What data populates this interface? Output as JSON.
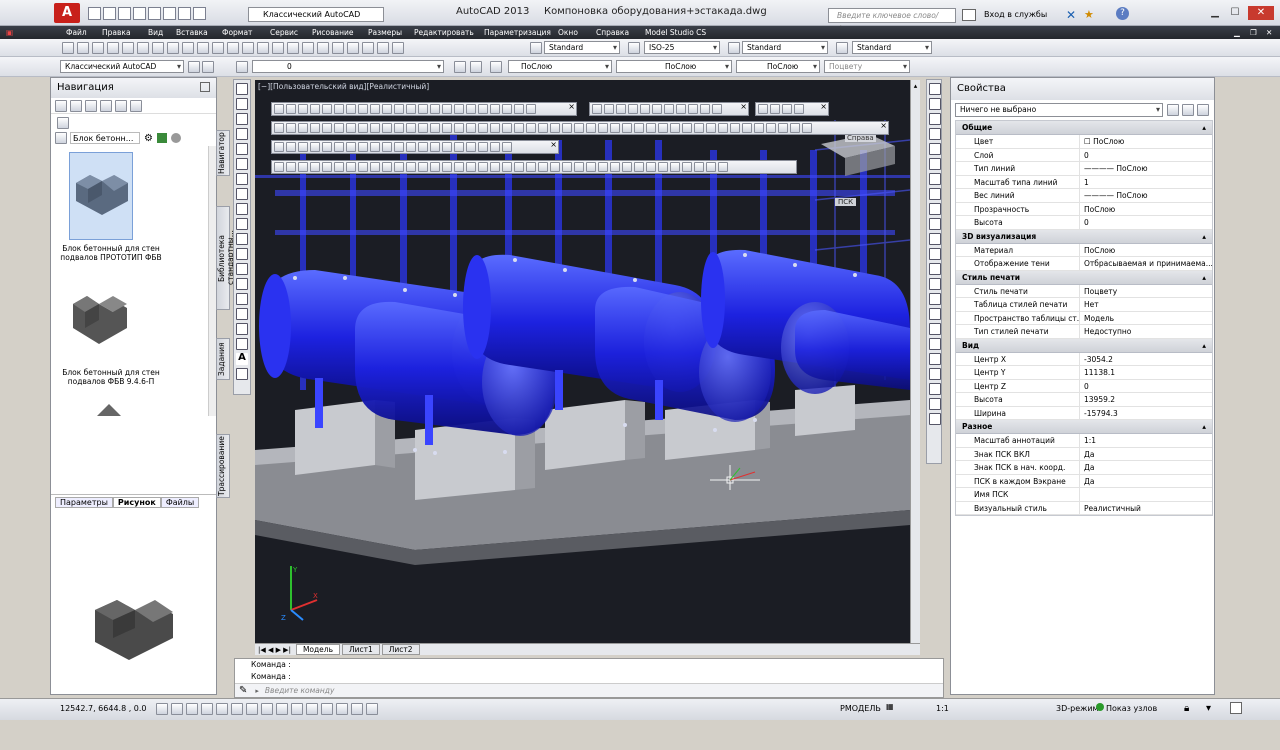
{
  "title_bar": {
    "app_logo": "A",
    "workspace": "Классический AutoCAD",
    "app_name": "AutoCAD 2013",
    "document": "Компоновка оборудования+эстакада.dwg",
    "search_placeholder": "Введите ключевое слово/фразу",
    "login": "Вход в службы"
  },
  "menu": [
    "Файл",
    "Правка",
    "Вид",
    "Вставка",
    "Формат",
    "Сервис",
    "Рисование",
    "Размеры",
    "Редактировать",
    "Параметризация",
    "Окно",
    "Справка",
    "Model Studio CS"
  ],
  "toolbar2": {
    "text_style": "Standard",
    "dim_style": "ISO-25",
    "table_style": "Standard",
    "mleader_style": "Standard"
  },
  "toolbar3": {
    "workspace": "Классический AutoCAD",
    "layer": "0",
    "color": "ПоСлою",
    "linetype": "ПоСлою",
    "lineweight": "ПоСлою",
    "plotstyle": "Поцвету"
  },
  "nav_panel": {
    "title": "Навигация",
    "block_name": "Блок бетонн...",
    "items": [
      {
        "label": "Блок бетонный для стен подвалов ПРОТОТИП ФБВ"
      },
      {
        "label": "Блок бетонный для стен подвалов ФБВ 9.4.6-П"
      }
    ],
    "tabs": [
      "Параметры",
      "Рисунок",
      "Файлы"
    ],
    "side_tabs": [
      "Навигатор",
      "Библиотека стандартны...",
      "Задания",
      "Трассирование"
    ]
  },
  "viewport": {
    "label": "[−][Пользовательский вид][Реалистичный]",
    "wcs_label": "ПСК",
    "cube_label": "Справа"
  },
  "layout_tabs": [
    "Модель",
    "Лист1",
    "Лист2"
  ],
  "command": {
    "line1": "Команда :",
    "line2": "Команда :",
    "placeholder": "Введите команду"
  },
  "status_bar": {
    "coords": "12542.7, 6644.8 , 0.0",
    "model": "РМОДЕЛЬ",
    "scale": "1:1",
    "mode3d": "3D-режим",
    "show_nodes": "Показ узлов"
  },
  "properties": {
    "title": "Свойства",
    "selection": "Ничего не выбрано",
    "groups": [
      {
        "name": "Общие",
        "rows": [
          [
            "Цвет",
            "☐ ПоСлою"
          ],
          [
            "Слой",
            "0"
          ],
          [
            "Тип линий",
            "———— ПоСлою"
          ],
          [
            "Масштаб типа линий",
            "1"
          ],
          [
            "Вес линий",
            "———— ПоСлою"
          ],
          [
            "Прозрачность",
            "ПоСлою"
          ],
          [
            "Высота",
            "0"
          ]
        ]
      },
      {
        "name": "3D визуализация",
        "rows": [
          [
            "Материал",
            "ПоСлою"
          ],
          [
            "Отображение тени",
            "Отбрасываемая и принимаема..."
          ]
        ]
      },
      {
        "name": "Стиль печати",
        "rows": [
          [
            "Стиль печати",
            "Поцвету"
          ],
          [
            "Таблица стилей печати",
            "Нет"
          ],
          [
            "Пространство таблицы ст...",
            "Модель"
          ],
          [
            "Тип стилей печати",
            "Недоступно"
          ]
        ]
      },
      {
        "name": "Вид",
        "rows": [
          [
            "Центр X",
            "-3054.2"
          ],
          [
            "Центр Y",
            "11138.1"
          ],
          [
            "Центр Z",
            "0"
          ],
          [
            "Высота",
            "13959.2"
          ],
          [
            "Ширина",
            "-15794.3"
          ]
        ]
      },
      {
        "name": "Разное",
        "rows": [
          [
            "Масштаб аннотаций",
            "1:1"
          ],
          [
            "Знак ПСК ВКЛ",
            "Да"
          ],
          [
            "Знак ПСК в нач. коорд.",
            "Да"
          ],
          [
            "ПСК в каждом Вэкране",
            "Да"
          ],
          [
            "Имя ПСК",
            ""
          ],
          [
            "Визуальный стиль",
            "Реалистичный"
          ]
        ]
      }
    ]
  },
  "colors": {
    "accent": "#c8201a",
    "vessel": "#2a2ee8",
    "viewport_bg": "#1a1c22"
  }
}
